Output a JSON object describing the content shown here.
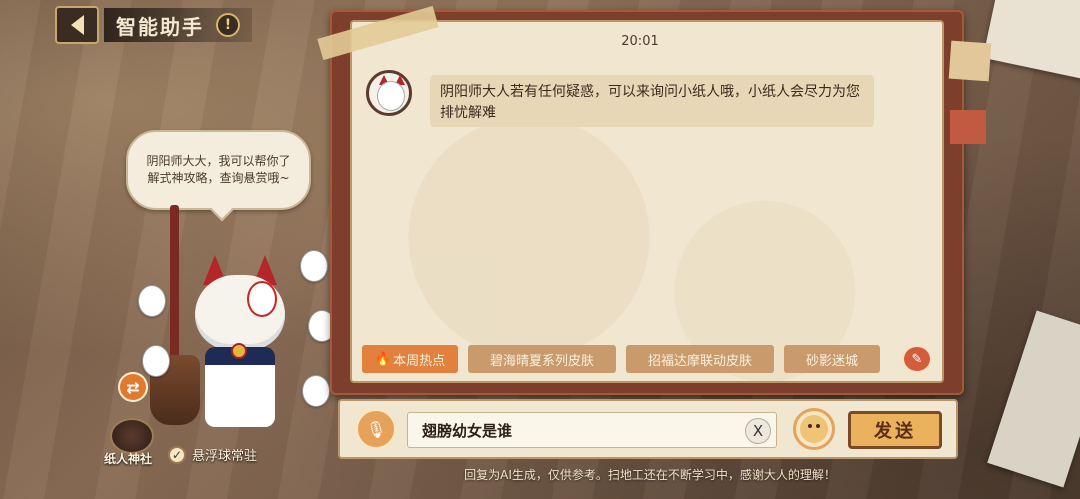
{
  "header": {
    "title": "智能助手"
  },
  "assistant": {
    "speech": "阴阳师大大，我可以帮你了解式神攻略，查询悬赏哦~",
    "shrine_label": "纸人神社",
    "float_label": "悬浮球常驻",
    "float_checked": true
  },
  "chat": {
    "timestamp": "20:01",
    "messages": [
      {
        "from": "assistant",
        "text": "阴阳师大人若有任何疑惑，可以来询问小纸人哦，小纸人会尽力为您排忧解难"
      }
    ]
  },
  "topics": [
    {
      "label": "本周热点",
      "hot": true
    },
    {
      "label": "碧海晴夏系列皮肤"
    },
    {
      "label": "招福达摩联动皮肤"
    },
    {
      "label": "砂影迷城"
    }
  ],
  "input": {
    "value": "翅膀幼女是谁",
    "send_label": "发送",
    "clear_symbol": "X"
  },
  "footer": {
    "disclaimer": "回复为AI生成，仅供参考。扫地工还在不断学习中，感谢大人的理解！"
  },
  "colors": {
    "panel": "#f1e6cf",
    "frame": "#7e3e2c",
    "accent": "#e2813e"
  }
}
